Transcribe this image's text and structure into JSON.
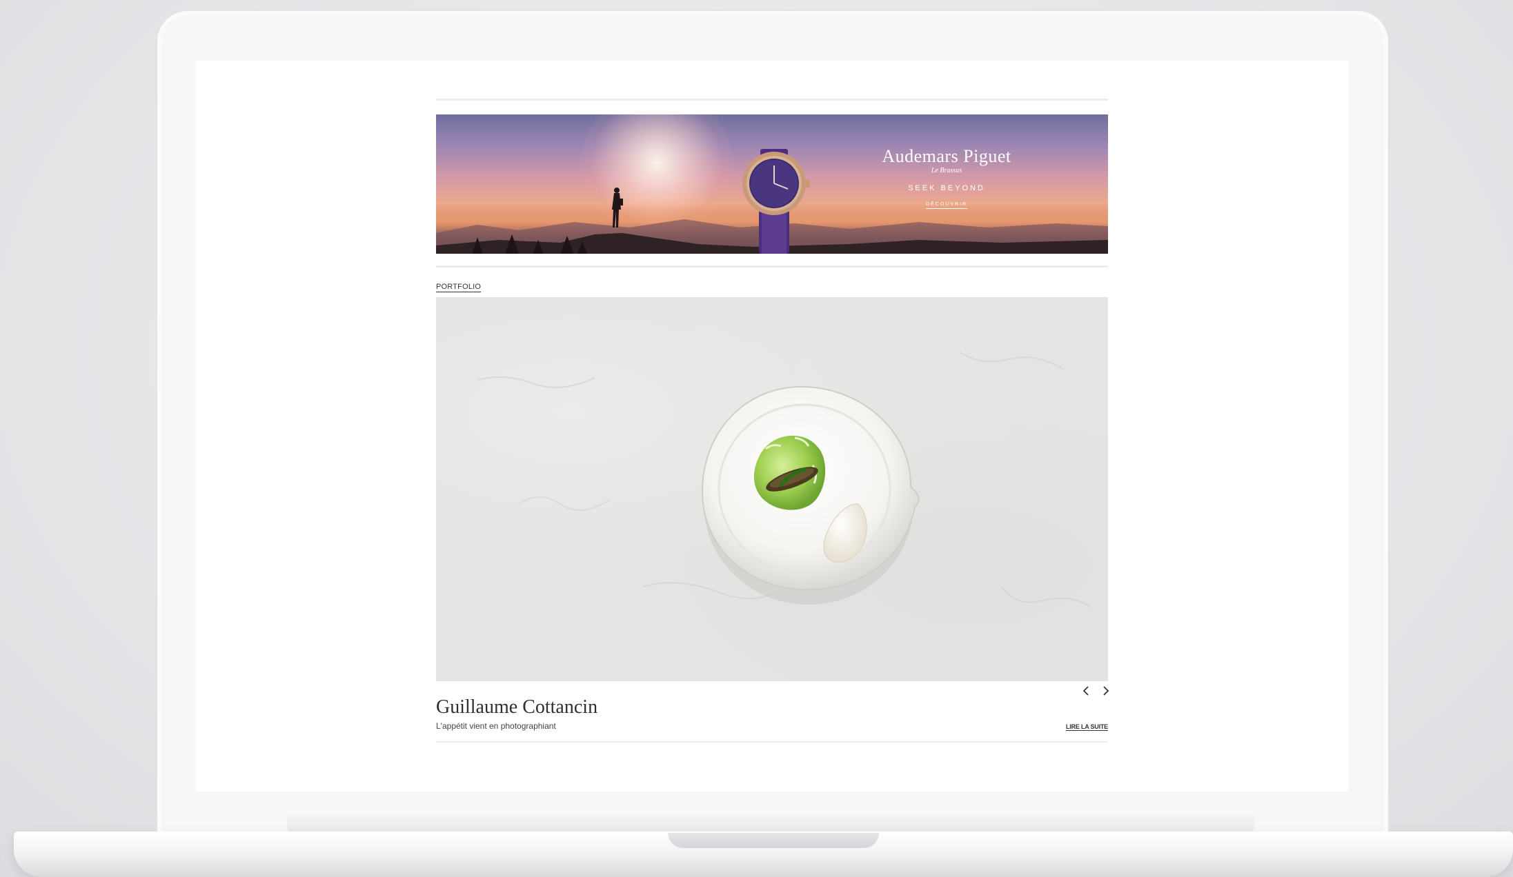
{
  "ad": {
    "brand": "Audemars Piguet",
    "location": "Le Brassus",
    "tagline": "SEEK BEYOND",
    "cta": "DÉCOUVRIR"
  },
  "section": {
    "label": "PORTFOLIO"
  },
  "article": {
    "title": "Guillaume Cottancin",
    "subtitle": "L'appétit vient en photographiant",
    "read_more": "LIRE LA SUITE"
  },
  "carousel": {
    "prev_icon": "chevron-left-icon",
    "next_icon": "chevron-right-icon"
  },
  "colors": {
    "accent_text": "#2e2e2e",
    "divider": "#ececec",
    "ad_purple": "#5a3c8c"
  }
}
